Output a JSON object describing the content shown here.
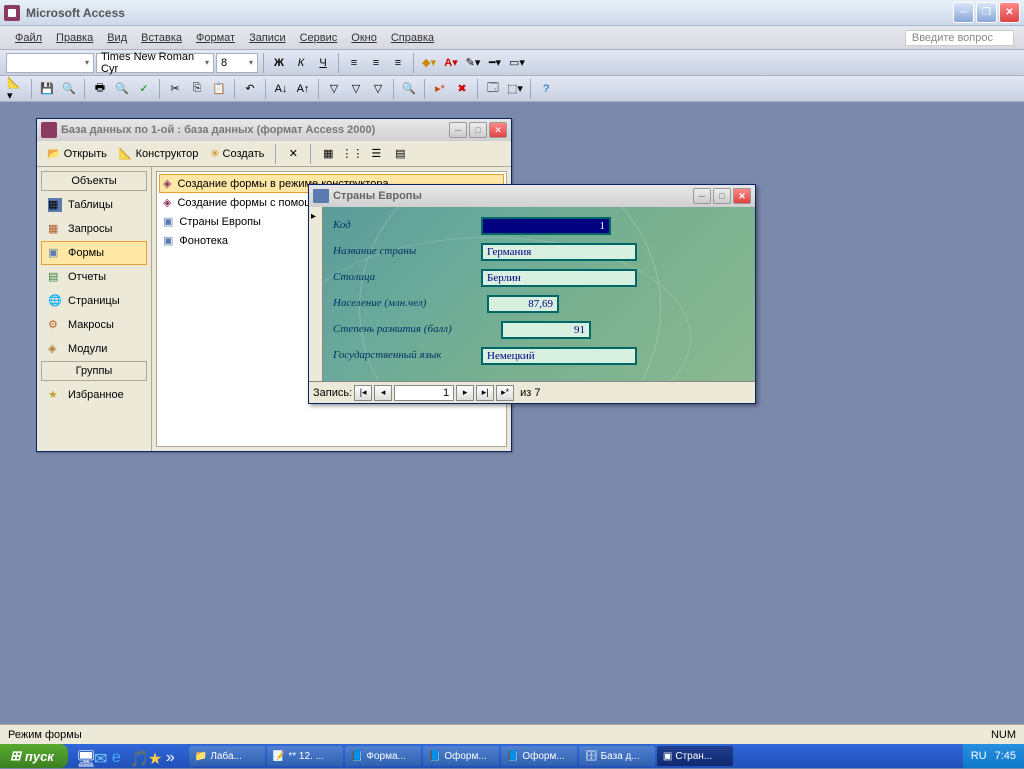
{
  "app": {
    "title": "Microsoft Access"
  },
  "menu": {
    "items": [
      "Файл",
      "Правка",
      "Вид",
      "Вставка",
      "Формат",
      "Записи",
      "Сервис",
      "Окно",
      "Справка"
    ],
    "ask": "Введите вопрос"
  },
  "format_toolbar": {
    "font": "Times New Roman Cyr",
    "size": "8"
  },
  "db_window": {
    "title": "База данных по 1-ой : база данных (формат Access 2000)",
    "toolbar": {
      "open": "Открыть",
      "design": "Конструктор",
      "create": "Создать"
    },
    "sidebar": {
      "header_objects": "Объекты",
      "header_groups": "Группы",
      "items": [
        "Таблицы",
        "Запросы",
        "Формы",
        "Отчеты",
        "Страницы",
        "Макросы",
        "Модули"
      ],
      "favorites": "Избранное"
    },
    "list": [
      "Создание формы в режиме конструктора",
      "Создание формы с помощью мастера",
      "Страны Европы",
      "Фонотека"
    ]
  },
  "form_window": {
    "title": "Страны Европы",
    "fields": {
      "code": {
        "label": "Код",
        "value": "1"
      },
      "name": {
        "label": "Название страны",
        "value": "Германия"
      },
      "capital": {
        "label": "Столица",
        "value": "Берлин"
      },
      "population": {
        "label": "Население (млн.чел)",
        "value": "87,69"
      },
      "development": {
        "label": "Степень развития (балл)",
        "value": "91"
      },
      "language": {
        "label": "Государственный язык",
        "value": "Немецкий"
      }
    },
    "nav": {
      "label": "Запись:",
      "current": "1",
      "total": "из  7"
    }
  },
  "statusbar": {
    "mode": "Режим формы",
    "num": "NUM"
  },
  "taskbar": {
    "start": "пуск",
    "items": [
      "Лаба...",
      "** 12. ...",
      "Форма...",
      "Оформ...",
      "Оформ...",
      "База д...",
      "Стран..."
    ],
    "lang": "RU",
    "time": "7:45"
  }
}
